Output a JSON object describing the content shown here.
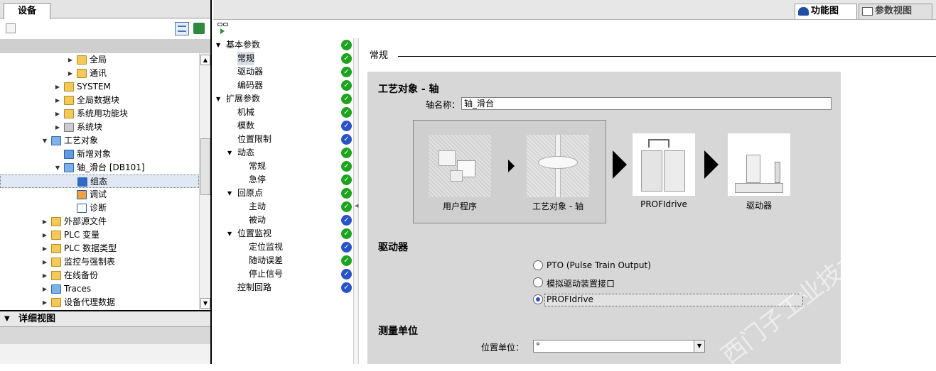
{
  "left": {
    "tab_label": "设备",
    "tree": [
      {
        "label": "全局",
        "indent": 3,
        "arrow": "▶",
        "icon": "folder-icon"
      },
      {
        "label": "通讯",
        "indent": 3,
        "arrow": "▶",
        "icon": "folder-icon"
      },
      {
        "label": "SYSTEM",
        "indent": 2,
        "arrow": "▶",
        "icon": "folder-icon"
      },
      {
        "label": "全局数据块",
        "indent": 2,
        "arrow": "▶",
        "icon": "folder-icon"
      },
      {
        "label": "系统用功能块",
        "indent": 2,
        "arrow": "▶",
        "icon": "folder-icon"
      },
      {
        "label": "系统块",
        "indent": 2,
        "arrow": "▶",
        "icon": "system-block-icon"
      },
      {
        "label": "工艺对象",
        "indent": 1,
        "arrow": "▼",
        "icon": "technology-object-icon"
      },
      {
        "label": "新增对象",
        "indent": 2,
        "arrow": "",
        "icon": "add-object-icon"
      },
      {
        "label": "轴_滑台 [DB101]",
        "indent": 2,
        "arrow": "▼",
        "icon": "axis-icon"
      },
      {
        "label": "组态",
        "indent": 3,
        "arrow": "",
        "icon": "configuration-icon",
        "selected": true
      },
      {
        "label": "调试",
        "indent": 3,
        "arrow": "",
        "icon": "commissioning-icon"
      },
      {
        "label": "诊断",
        "indent": 3,
        "arrow": "",
        "icon": "diagnostics-icon"
      },
      {
        "label": "外部源文件",
        "indent": 1,
        "arrow": "▶",
        "icon": "folder-icon"
      },
      {
        "label": "PLC 变量",
        "indent": 1,
        "arrow": "▶",
        "icon": "folder-icon"
      },
      {
        "label": "PLC 数据类型",
        "indent": 1,
        "arrow": "▶",
        "icon": "folder-icon"
      },
      {
        "label": "监控与强制表",
        "indent": 1,
        "arrow": "▶",
        "icon": "folder-icon"
      },
      {
        "label": "在线备份",
        "indent": 1,
        "arrow": "▶",
        "icon": "folder-icon"
      },
      {
        "label": "Traces",
        "indent": 1,
        "arrow": "▶",
        "icon": "traces-icon"
      },
      {
        "label": "设备代理数据",
        "indent": 1,
        "arrow": "▶",
        "icon": "folder-icon"
      }
    ],
    "detail_title": "详细视图"
  },
  "right": {
    "tabs": [
      {
        "label": "功能图",
        "active": true
      },
      {
        "label": "参数视图",
        "active": false
      }
    ],
    "nav": [
      {
        "label": "基本参数",
        "level": 0,
        "arrow": "▼",
        "status": "ok"
      },
      {
        "label": "常规",
        "level": 1,
        "arrow": "",
        "status": "ok",
        "selected": true
      },
      {
        "label": "驱动器",
        "level": 1,
        "arrow": "",
        "status": "ok"
      },
      {
        "label": "编码器",
        "level": 1,
        "arrow": "",
        "status": "ok"
      },
      {
        "label": "扩展参数",
        "level": 0,
        "arrow": "▼",
        "status": "ok"
      },
      {
        "label": "机械",
        "level": 1,
        "arrow": "",
        "status": "ok"
      },
      {
        "label": "模数",
        "level": 1,
        "arrow": "",
        "status": "blue"
      },
      {
        "label": "位置限制",
        "level": 1,
        "arrow": "",
        "status": "blue"
      },
      {
        "label": "动态",
        "level": 1,
        "arrow": "▼",
        "status": "ok"
      },
      {
        "label": "常规",
        "level": 2,
        "arrow": "",
        "status": "ok"
      },
      {
        "label": "急停",
        "level": 2,
        "arrow": "",
        "status": "ok"
      },
      {
        "label": "回原点",
        "level": 1,
        "arrow": "▼",
        "status": "ok"
      },
      {
        "label": "主动",
        "level": 2,
        "arrow": "",
        "status": "ok"
      },
      {
        "label": "被动",
        "level": 2,
        "arrow": "",
        "status": "blue"
      },
      {
        "label": "位置监视",
        "level": 1,
        "arrow": "▼",
        "status": "ok"
      },
      {
        "label": "定位监视",
        "level": 2,
        "arrow": "",
        "status": "blue"
      },
      {
        "label": "随动误差",
        "level": 2,
        "arrow": "",
        "status": "ok"
      },
      {
        "label": "停止信号",
        "level": 2,
        "arrow": "",
        "status": "blue"
      },
      {
        "label": "控制回路",
        "level": 1,
        "arrow": "",
        "status": "blue"
      }
    ],
    "section_title": "常规",
    "tech_object": {
      "heading": "工艺对象 - 轴",
      "axis_name_label": "轴名称：",
      "axis_name_value": "轴_滑台"
    },
    "diagram": {
      "user_program": "用户程序",
      "tech_object_axis": "工艺对象 - 轴",
      "profidrive": "PROFIdrive",
      "drive": "驱动器"
    },
    "drive": {
      "heading": "驱动器",
      "options": [
        {
          "label": "PTO (Pulse Train Output)",
          "selected": false
        },
        {
          "label": "模拟驱动装置接口",
          "selected": false
        },
        {
          "label": "PROFIdrive",
          "selected": true
        }
      ]
    },
    "units": {
      "heading": "测量单位",
      "position_unit_label": "位置单位：",
      "position_unit_value": "°"
    },
    "watermark": "西门子工业技术论坛 support.industry.siemens.com/cs"
  },
  "colors": {
    "status_ok": "#1ea31e",
    "status_blue": "#2a52c8",
    "panel": "#d7d7d7"
  }
}
